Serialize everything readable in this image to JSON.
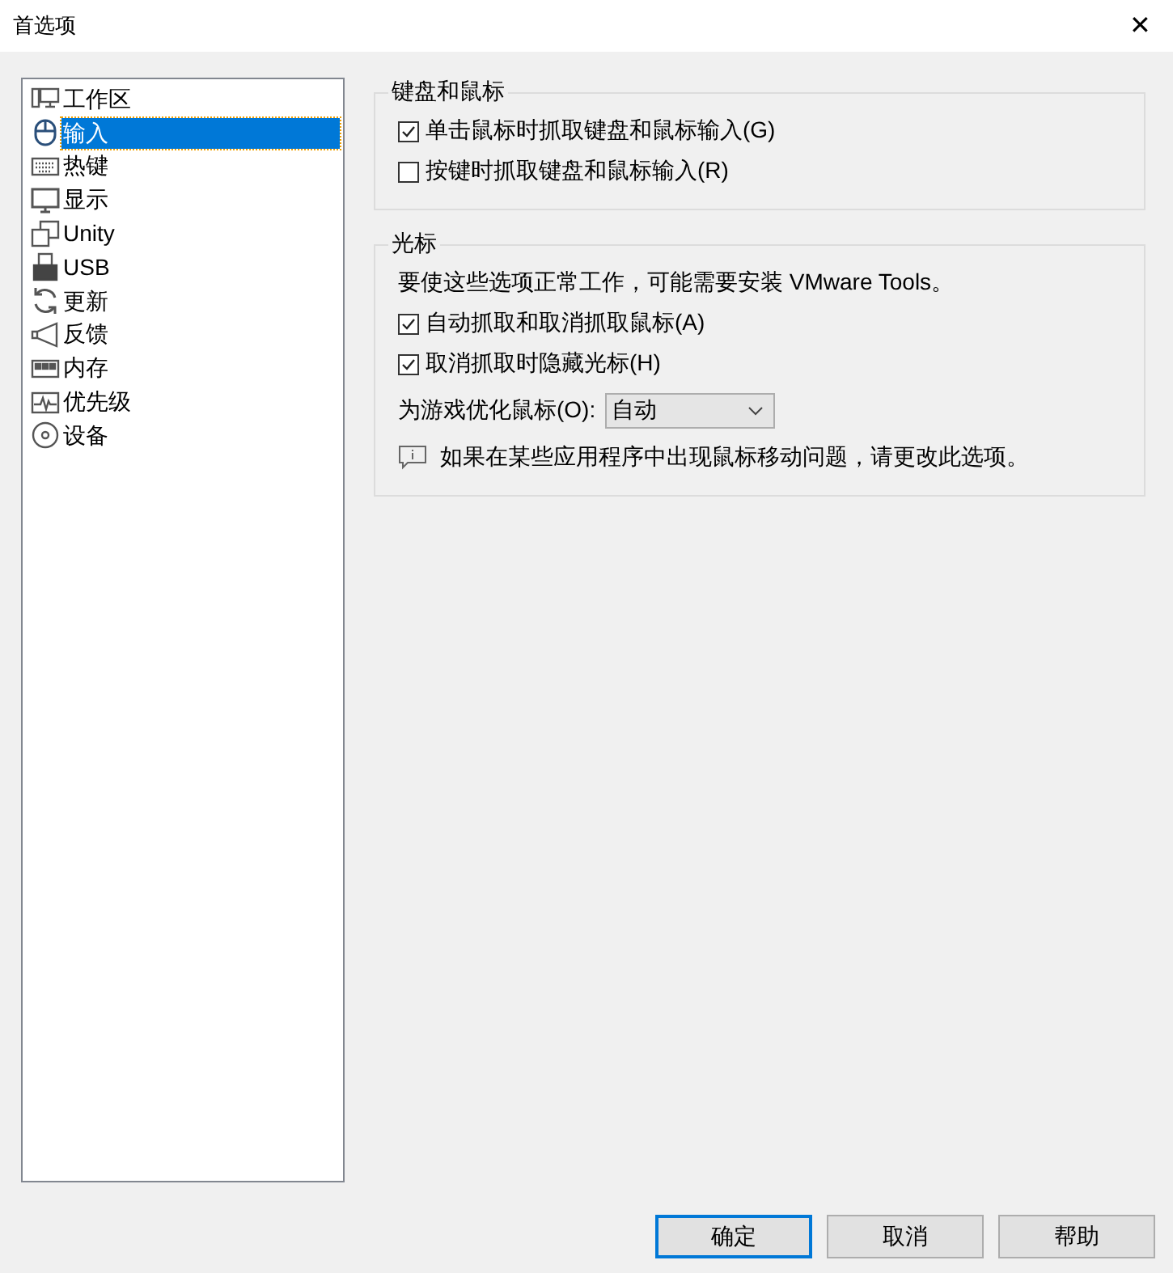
{
  "window": {
    "title": "首选项",
    "close": "✕"
  },
  "sidebar": {
    "items": [
      {
        "label": "工作区",
        "selected": false
      },
      {
        "label": "输入",
        "selected": true
      },
      {
        "label": "热键",
        "selected": false
      },
      {
        "label": "显示",
        "selected": false
      },
      {
        "label": "Unity",
        "selected": false
      },
      {
        "label": "USB",
        "selected": false
      },
      {
        "label": "更新",
        "selected": false
      },
      {
        "label": "反馈",
        "selected": false
      },
      {
        "label": "内存",
        "selected": false
      },
      {
        "label": "优先级",
        "selected": false
      },
      {
        "label": "设备",
        "selected": false
      }
    ]
  },
  "groups": [
    {
      "title": "键盘和鼠标",
      "rows": [
        {
          "kind": "checkbox",
          "label": "单击鼠标时抓取键盘和鼠标输入(G)",
          "checked": true
        },
        {
          "kind": "checkbox",
          "label": "按键时抓取键盘和鼠标输入(R)",
          "checked": false
        }
      ]
    },
    {
      "title": "光标",
      "rows": [
        {
          "kind": "note",
          "text": "要使这些选项正常工作，可能需要安装 VMware Tools。"
        },
        {
          "kind": "checkbox",
          "label": "自动抓取和取消抓取鼠标(A)",
          "checked": true
        },
        {
          "kind": "checkbox",
          "label": "取消抓取时隐藏光标(H)",
          "checked": true
        },
        {
          "kind": "select",
          "label": "为游戏优化鼠标(O):",
          "value": "自动"
        },
        {
          "kind": "info",
          "text": "如果在某些应用程序中出现鼠标移动问题，请更改此选项。"
        }
      ]
    }
  ],
  "buttons": [
    {
      "label": "确定",
      "default": true
    },
    {
      "label": "取消",
      "default": false
    },
    {
      "label": "帮助",
      "default": false
    }
  ]
}
